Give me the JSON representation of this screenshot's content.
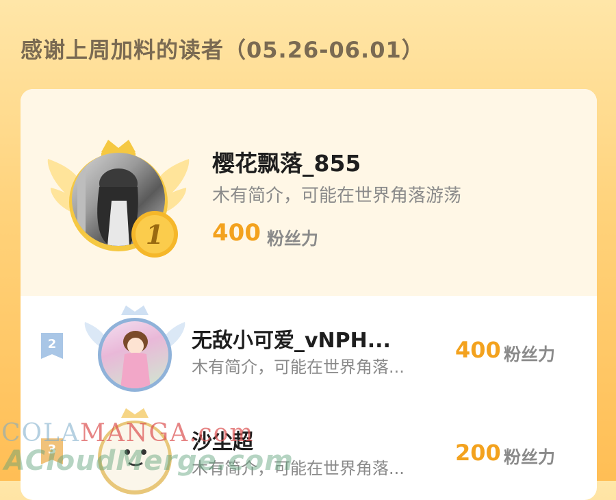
{
  "page": {
    "title": "感谢上周加料的读者（05.26-06.01）"
  },
  "colors": {
    "accent": "#f3a21e",
    "rank1_gold": "#f5b72a",
    "rank2_blue": "#a9c6e6"
  },
  "readers": [
    {
      "rank": "1",
      "name": "樱花飘落_855",
      "bio": "木有简介，可能在世界角落游荡",
      "points": "400",
      "points_unit": "粉丝力"
    },
    {
      "rank": "2",
      "name": "无敌小可爱_vNPH...",
      "bio": "木有简介，可能在世界角落...",
      "points": "400",
      "points_unit": "粉丝力"
    },
    {
      "rank": "3",
      "name": "沙尘超",
      "bio": "木有简介，可能在世界角落...",
      "points": "200",
      "points_unit": "粉丝力"
    }
  ],
  "watermark": {
    "line1_a": "COLA",
    "line1_b": "MANGA",
    "line1_c": ".com",
    "line2": "ACloudMerge.com"
  }
}
